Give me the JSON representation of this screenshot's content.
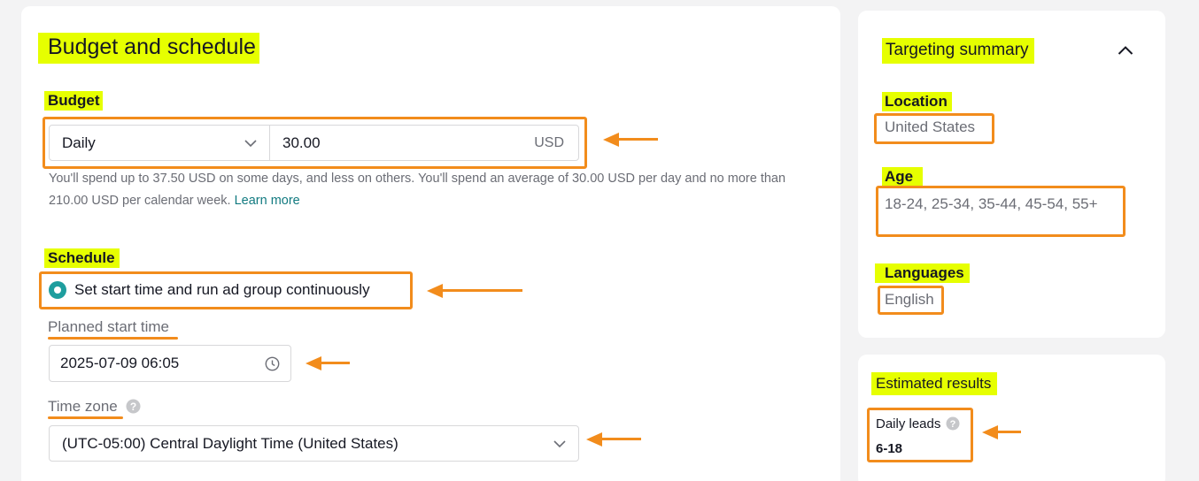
{
  "budget_schedule": {
    "title": "Budget and schedule",
    "budget_label": "Budget",
    "budget_type": "Daily",
    "budget_amount": "30.00",
    "currency": "USD",
    "budget_note": "You'll spend up to 37.50 USD on some days, and less on others. You'll spend an average of 30.00 USD per day and no more than 210.00 USD per calendar week.",
    "learn_more": "Learn more",
    "schedule_label": "Schedule",
    "schedule_option": "Set start time and run ad group continuously",
    "planned_start_label": "Planned start time",
    "planned_start_value": "2025-07-09 06:05",
    "timezone_label": "Time zone",
    "timezone_value": "(UTC-05:00) Central Daylight Time (United States)"
  },
  "targeting_summary": {
    "title": "Targeting summary",
    "location_label": "Location",
    "location_value": "United States",
    "age_label": "Age",
    "age_value": "18-24, 25-34, 35-44, 45-54, 55+",
    "languages_label": "Languages",
    "languages_value": "English"
  },
  "estimated_results": {
    "title": "Estimated results",
    "daily_leads_label": "Daily leads",
    "daily_leads_value": "6-18"
  },
  "colors": {
    "highlight": "#e6ff00",
    "annotation_orange": "#f28c1c",
    "radio_teal": "#1e9e9e",
    "link_teal": "#127a80"
  },
  "icons": [
    "chevron-down-icon",
    "clock-icon",
    "help-icon",
    "chevron-up-icon",
    "radio-selected-icon",
    "arrow-left-icon"
  ]
}
